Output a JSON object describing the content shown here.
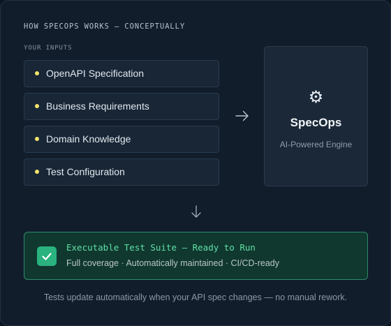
{
  "heading": "HOW SPECOPS WORKS — CONCEPTUALLY",
  "inputs": {
    "section_label": "YOUR INPUTS",
    "items": [
      {
        "label": "OpenAPI Specification"
      },
      {
        "label": "Business Requirements"
      },
      {
        "label": "Domain Knowledge"
      },
      {
        "label": "Test Configuration"
      }
    ],
    "dot_color": "#f3e36b"
  },
  "flow": {
    "right_arrow_icon": "arrow-right-icon",
    "down_arrow_icon": "arrow-down-icon"
  },
  "engine": {
    "icon": "gear-icon",
    "icon_glyph": "⚙",
    "name": "SpecOps",
    "subtitle": "AI-Powered Engine"
  },
  "result": {
    "icon": "check-icon",
    "title": "Executable Test Suite — Ready to Run",
    "description": "Full coverage · Automatically maintained · CI/CD-ready",
    "accent_color": "#5fe0a4"
  },
  "footer": "Tests update automatically when your API spec changes — no manual rework.",
  "colors": {
    "background": "#0b141f",
    "panel": "#111d2b",
    "success": "#2ab27f"
  }
}
